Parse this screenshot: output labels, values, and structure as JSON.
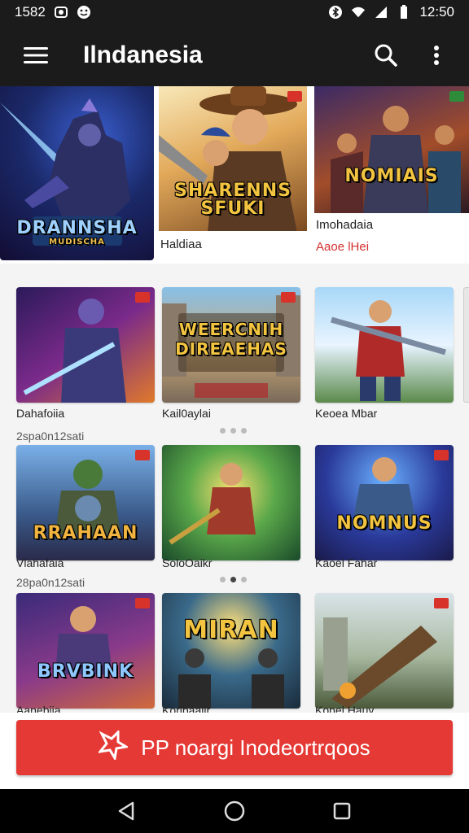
{
  "status_bar": {
    "time_left": "1582",
    "time_right": "12:50"
  },
  "app_bar": {
    "title": "Ilndanesia"
  },
  "featured": [
    {
      "art_title": "DRANNSHA",
      "sub_art": "MUDISCHA"
    },
    {
      "art_title": "SHARENNS SFUKI",
      "caption": "Haldiaa"
    },
    {
      "art_title": "NOMIAIS",
      "caption": "Imohadaia",
      "subcaption": "Aaoe lHei"
    }
  ],
  "grid": {
    "rows": [
      {
        "items": [
          {
            "art_title": "",
            "label": "Dahafoiia"
          },
          {
            "art_title": "WEERCNIH DIREAEHAS",
            "label": "Kail0aylai"
          },
          {
            "art_title": "",
            "label": "Keoea Mbar"
          }
        ],
        "sub": "2spa0n12sati"
      },
      {
        "items": [
          {
            "art_title": "RRAHAAN",
            "label": "Vlahafaia"
          },
          {
            "art_title": "",
            "label": "SoloOaikr"
          },
          {
            "art_title": "NOMNUS",
            "label": "Kaoel Fahar"
          }
        ],
        "sub": "28pa0n12sati"
      },
      {
        "items": [
          {
            "art_title": "BRVBINK",
            "label": "Aanebiia"
          },
          {
            "art_title": "MIRAN",
            "label": "Korlbaailr"
          },
          {
            "art_title": "",
            "label": "Konel Hauy"
          }
        ]
      }
    ]
  },
  "cta": {
    "label": "PP noargi Inodeortrqoos"
  },
  "colors": {
    "accent": "#e53935",
    "bar": "#1b1b1b"
  }
}
